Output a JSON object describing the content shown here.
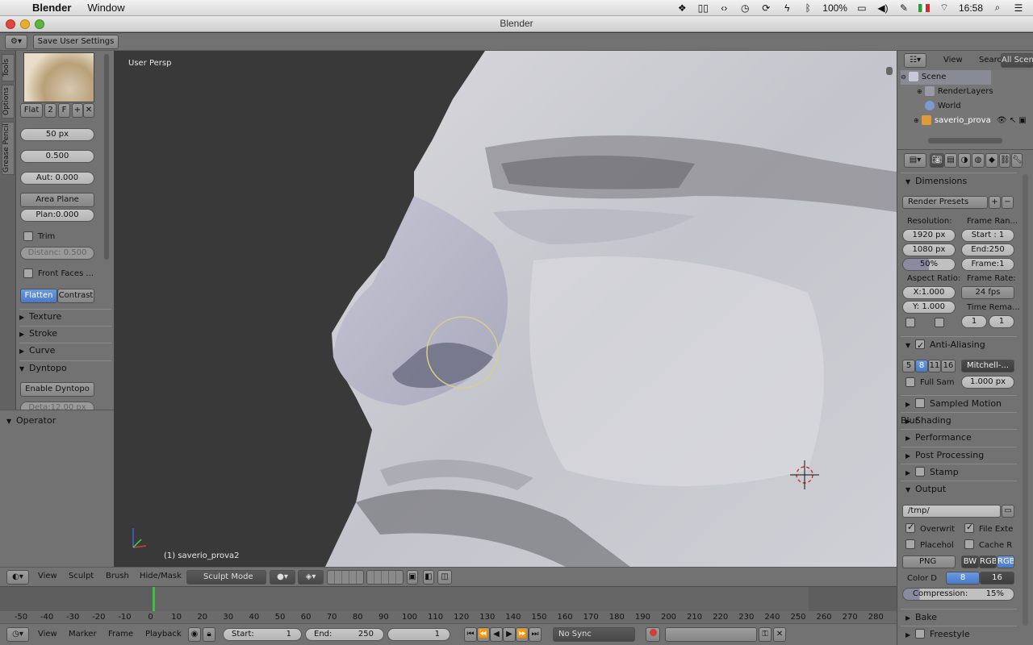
{
  "menubar": {
    "app": "Blender",
    "menus": [
      "Window"
    ],
    "battery": "100%",
    "time": "16:58"
  },
  "window": {
    "title": "Blender"
  },
  "info": {
    "save_label": "Save User Settings"
  },
  "tool_tabs": [
    "Tools",
    "Options",
    "Grease Pencil"
  ],
  "brush": {
    "mode_flat": "Flat",
    "mode_2": "2",
    "mode_f": "F",
    "radius": "50 px",
    "strength": "0.500",
    "autosmooth": "Aut: 0.000",
    "plane": "Area Plane",
    "plane_offset": "Plan:0.000",
    "trim": "Trim",
    "distance": "Distanc: 0.500",
    "front_faces": "Front Faces ...",
    "flatten": "Flatten",
    "contrast": "Contrast"
  },
  "panels": {
    "texture": "Texture",
    "stroke": "Stroke",
    "curve": "Curve",
    "dyntopo": "Dyntopo",
    "enable_dyntopo": "Enable Dyntopo",
    "detail": "Deta:12.00 px",
    "operator": "Operator"
  },
  "viewport": {
    "label": "User Persp",
    "object": "(1) saverio_prova2"
  },
  "view_header": {
    "view": "View",
    "sculpt": "Sculpt",
    "brush": "Brush",
    "hide_mask": "Hide/Mask",
    "mode": "Sculpt Mode"
  },
  "timeline": {
    "ticks": [
      "-50",
      "-40",
      "-30",
      "-20",
      "-10",
      "0",
      "10",
      "20",
      "30",
      "40",
      "50",
      "60",
      "70",
      "80",
      "90",
      "100",
      "110",
      "120",
      "130",
      "140",
      "150",
      "160",
      "170",
      "180",
      "190",
      "200",
      "210",
      "220",
      "230",
      "240",
      "250",
      "260",
      "270",
      "280"
    ],
    "view": "View",
    "marker": "Marker",
    "frame": "Frame",
    "playback": "Playback",
    "start": "Start:",
    "start_value": "1",
    "end": "End:",
    "end_value": "250",
    "current": "1",
    "sync": "No Sync"
  },
  "outliner": {
    "view": "View",
    "search": "Search",
    "filter": "All Scen",
    "items": [
      "Scene",
      "RenderLayers",
      "World",
      "saverio_prova"
    ]
  },
  "properties": {
    "dimensions": "Dimensions",
    "render_presets": "Render Presets",
    "resolution": "Resolution:",
    "frame_range": "Frame Ran...",
    "res_x": "1920 px",
    "res_y": "1080 px",
    "res_pct": "50%",
    "start": "Start : 1",
    "end": "End:250",
    "frame": "Frame:1",
    "aspect": "Aspect Ratio:",
    "frame_rate": "Frame Rate:",
    "aspect_x": "X:1.000",
    "aspect_y": "Y: 1.000",
    "fps": "24 fps",
    "time_remap": "Time Rema...",
    "remap_old": "1",
    "remap_new": "1",
    "anti_aliasing": "Anti-Aliasing",
    "aa_samples": [
      "5",
      "8",
      "11",
      "16"
    ],
    "aa_filter": "Mitchell-...",
    "full_sample": "Full Sam",
    "filter_size": "1.000 px",
    "motion_blur": "Sampled Motion Blur",
    "shading": "Shading",
    "performance": "Performance",
    "post_processing": "Post Processing",
    "stamp": "Stamp",
    "output": "Output",
    "output_path": "/tmp/",
    "overwrite": "Overwrit",
    "file_ext": "File Exte",
    "placeholders": "Placehol",
    "cache": "Cache R",
    "format": "PNG",
    "bw": "BW",
    "rgb": "RGB",
    "rgba": "RGB",
    "color_depth": "Color D",
    "depth_8": "8",
    "depth_16": "16",
    "compression": "Compression:",
    "compression_value": "15%",
    "bake": "Bake",
    "freestyle": "Freestyle"
  }
}
